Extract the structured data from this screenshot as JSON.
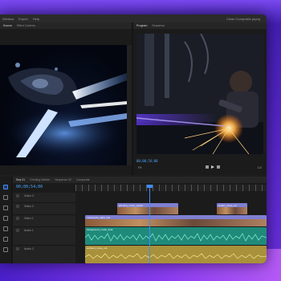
{
  "menu": {
    "items": [
      "Window",
      "Export",
      "Help"
    ],
    "title": "Clean Composite.prproj"
  },
  "source_monitor": {
    "tabs": [
      "Source",
      "Effect Controls"
    ],
    "image": "motorcycle-light-trails"
  },
  "program_monitor": {
    "tabs": [
      "Program",
      "Sequence"
    ],
    "image": "welder-sparks",
    "timecode": "00;00;54;00",
    "fit": "Fit",
    "scale": "1/2"
  },
  "timeline": {
    "tabs": [
      "Seq 01",
      "Grinding Welder",
      "Sequence 02",
      "Composite"
    ],
    "timecode": "00;00;54;00",
    "tracks": [
      {
        "name": "Video 3",
        "type": "video"
      },
      {
        "name": "Video 2",
        "type": "video"
      },
      {
        "name": "Video 1",
        "type": "video"
      },
      {
        "name": "Audio 1",
        "type": "audio"
      },
      {
        "name": "Audio 2",
        "type": "audio"
      }
    ],
    "clips": [
      {
        "name": "grinding_metal_sparks",
        "track": "Video 2"
      },
      {
        "name": "welder_close_up",
        "track": "Video 2"
      },
      {
        "name": "motorcycle_night_ride",
        "track": "Video 1"
      },
      {
        "name": "background_music_final",
        "track": "Audio 1"
      },
      {
        "name": "ambient_noise_mix",
        "track": "Audio 2"
      }
    ]
  },
  "colors": {
    "background": "#5b2bd6",
    "accent": "#3d8cff",
    "video_clip": "#7f7fd1",
    "audio_green": "#1f8a7a",
    "audio_yellow": "#a8913a"
  }
}
